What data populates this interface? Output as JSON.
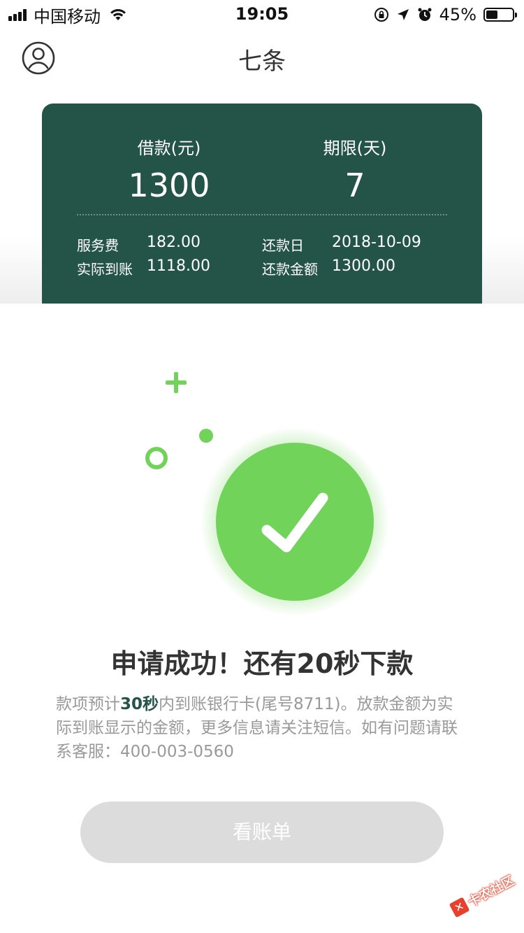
{
  "status_bar": {
    "carrier": "中国移动",
    "time": "19:05",
    "battery": "45%",
    "battery_level": 0.45
  },
  "nav": {
    "title": "七条"
  },
  "loan_card": {
    "amount_label": "借款(元)",
    "amount_value": "1300",
    "term_label": "期限(天)",
    "term_value": "7",
    "service_fee_label": "服务费",
    "service_fee_value": "182.00",
    "received_label": "实际到账",
    "received_value": "1118.00",
    "repay_date_label": "还款日",
    "repay_date_value": "2018-10-09",
    "repay_amount_label": "还款金额",
    "repay_amount_value": "1300.00"
  },
  "result": {
    "headline": "申请成功！还有20秒下款",
    "desc_before": "款项预计",
    "desc_highlight": "30秒",
    "desc_after": "内到账银行卡(尾号8711)。放款金额为实际到账显示的金额，更多信息请关注短信。如有问题请联系客服：400-003-0560"
  },
  "actions": {
    "view_bill_label": "看账单"
  },
  "watermark": {
    "text": "卡农社区"
  },
  "colors": {
    "card_bg": "#235447",
    "success_green": "#72d35a",
    "button_disabled": "#dcdcdc"
  }
}
